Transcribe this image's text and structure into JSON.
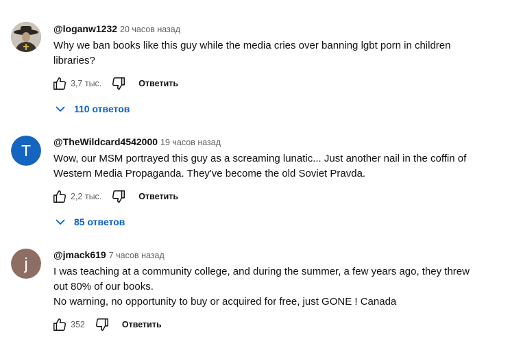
{
  "comments": [
    {
      "author": "@loganw1232",
      "time": "20 часов назад",
      "avatar_icon": "profile-photo",
      "lines": [
        "Why we ban books like this guy while the media cries over banning lgbt porn in children",
        "libraries?"
      ],
      "likes": "3,7 тыс.",
      "reply_label": "Ответить",
      "replies_label": "110 ответов"
    },
    {
      "author": "@TheWildcard4542000",
      "time": "19 часов назад",
      "avatar_letter": "T",
      "avatar_color": "#1565c0",
      "lines": [
        "Wow, our MSM portrayed this guy as a screaming lunatic... Just another nail in the coffin of",
        "Western Media Propaganda. They've become the old Soviet Pravda."
      ],
      "likes": "2,2 тыс.",
      "reply_label": "Ответить",
      "replies_label": "85 ответов"
    },
    {
      "author": "@jmack619",
      "time": "7 часов назад",
      "avatar_letter": "j",
      "avatar_color": "#8d6e63",
      "lines": [
        "I was teaching at a community college, and during the summer, a few years ago, they threw",
        "out 80% of our books.",
        "No warning, no opportunity to buy or acquired for free, just GONE ! Canada"
      ],
      "likes": "352",
      "reply_label": "Ответить"
    }
  ],
  "colors": {
    "link": "#065fd4",
    "secondary_text": "#606060"
  }
}
